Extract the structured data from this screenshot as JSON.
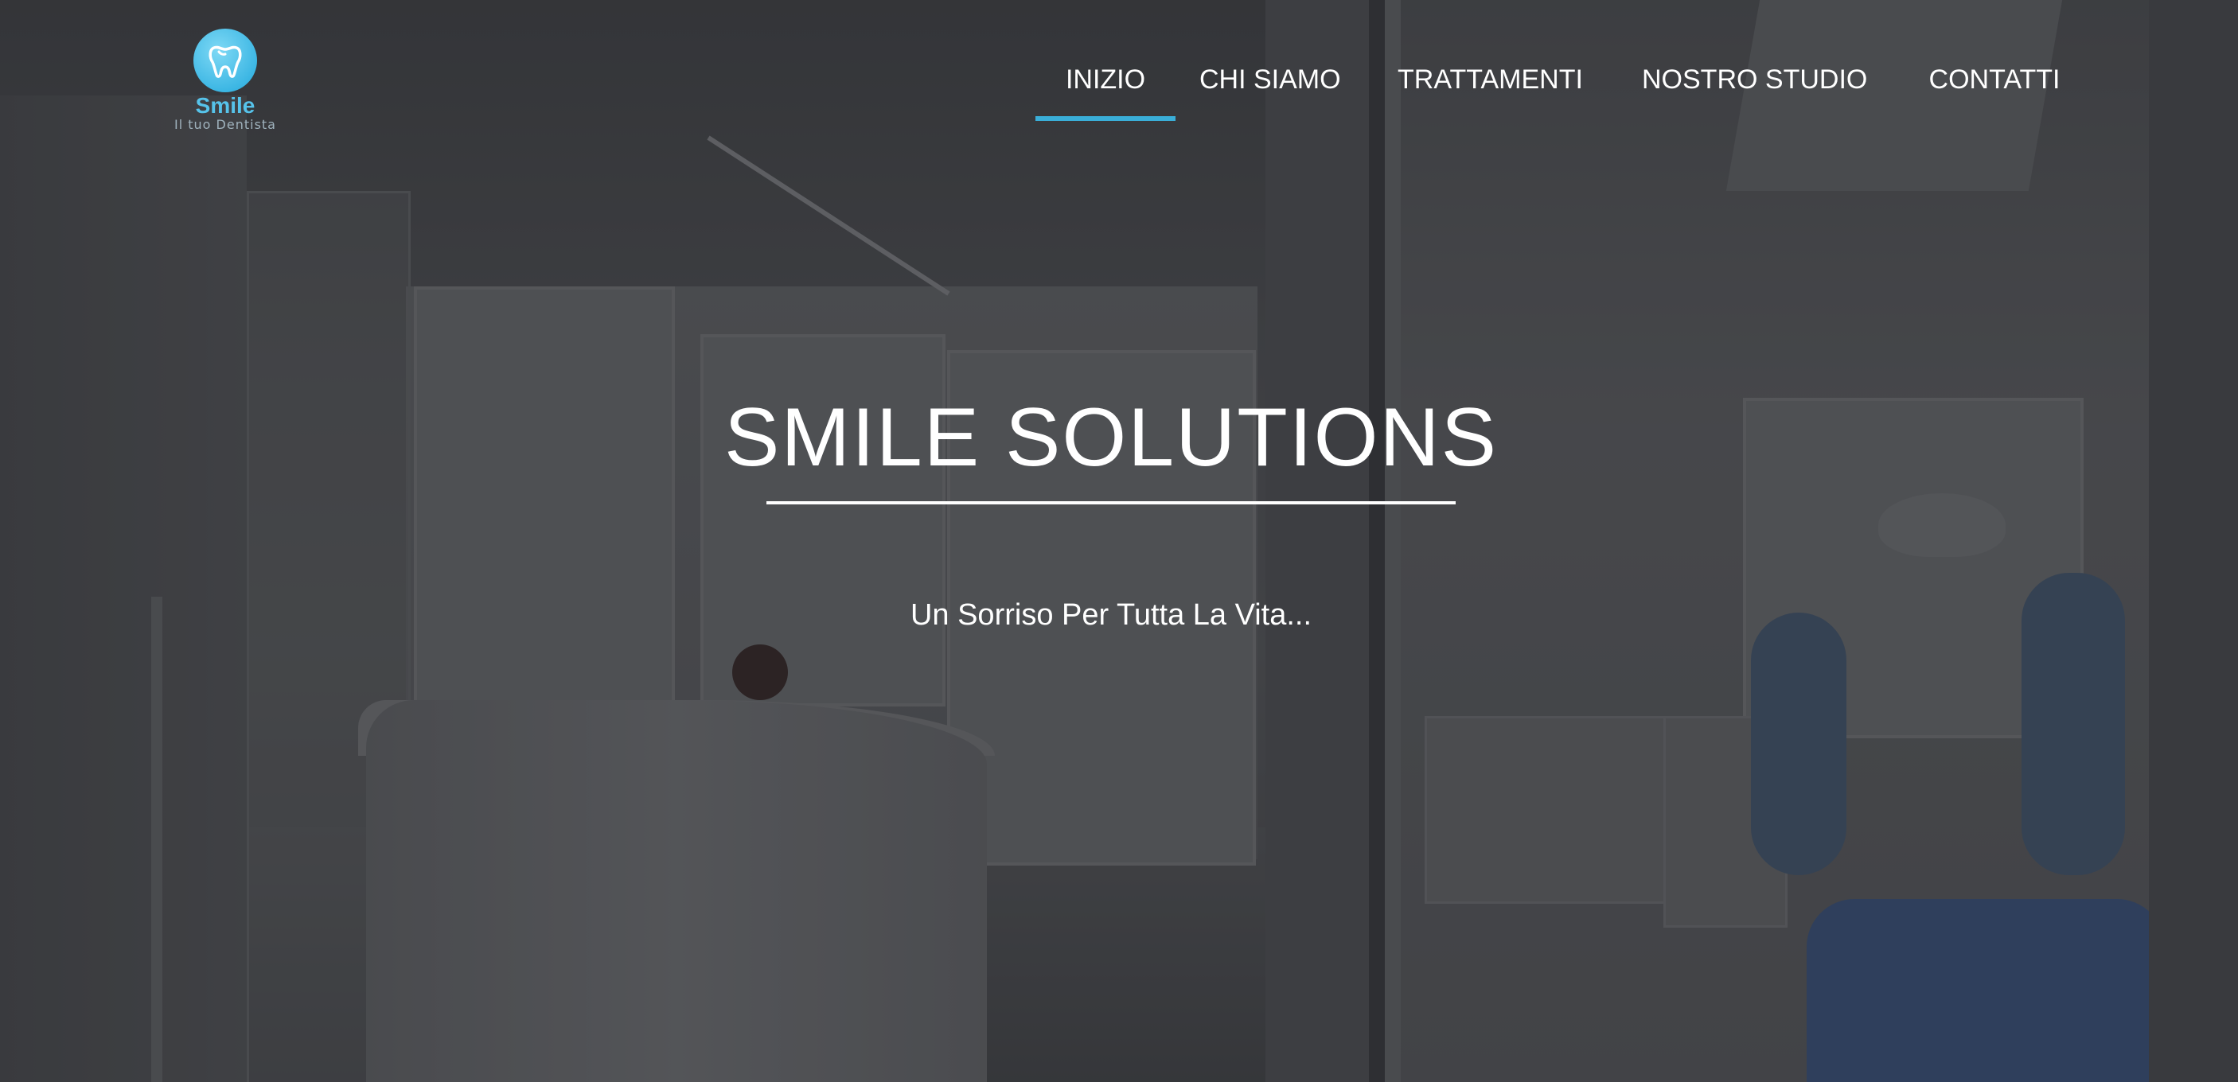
{
  "brand": {
    "logo_icon": "tooth-icon",
    "name": "Smile",
    "tagline": "Il tuo Dentista",
    "accent_color": "#3aaed8"
  },
  "nav": {
    "items": [
      {
        "label": "INIZIO",
        "active": true
      },
      {
        "label": "CHI SIAMO",
        "active": false
      },
      {
        "label": "TRATTAMENTI",
        "active": false
      },
      {
        "label": "NOSTRO STUDIO",
        "active": false
      },
      {
        "label": "CONTATTI",
        "active": false
      }
    ]
  },
  "hero": {
    "title": "SMILE SOLUTIONS",
    "subtitle": "Un Sorriso Per Tutta La Vita..."
  }
}
